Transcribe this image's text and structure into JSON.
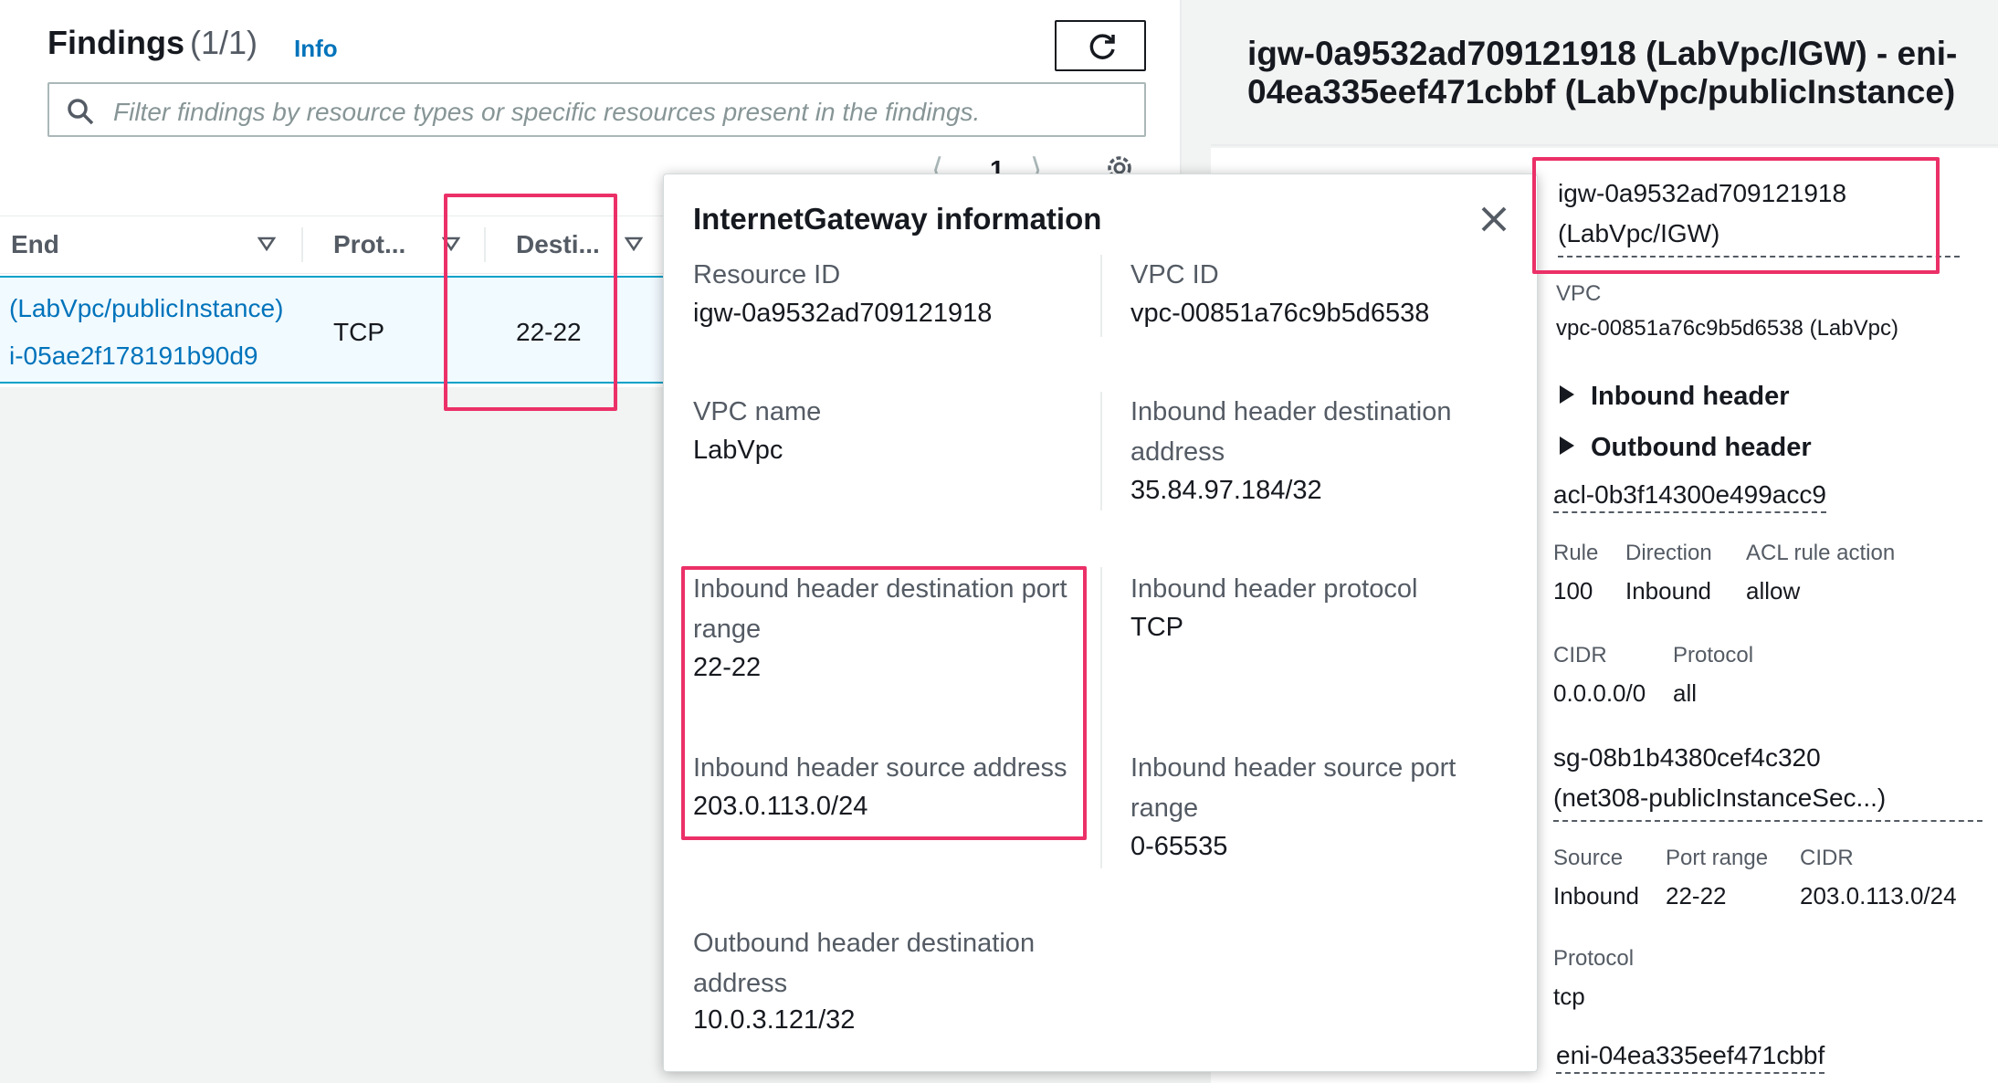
{
  "findings": {
    "title": "Findings",
    "count": "(1/1)",
    "info": "Info",
    "filter_placeholder": "Filter findings by resource types or specific resources present in the findings.",
    "page": "1"
  },
  "table": {
    "columns": [
      "End",
      "Prot...",
      "Desti..."
    ],
    "row": {
      "end_line1": "(LabVpc/publicInstance)",
      "end_line2": "i-05ae2f178191b90d9",
      "protocol": "TCP",
      "destination": "22-22"
    }
  },
  "detail": {
    "title": "igw-0a9532ad709121918 (LabVpc/IGW) - eni-04ea335eef471cbbf (LabVpc/publicInstance)",
    "igw_line1": "igw-0a9532ad709121918",
    "igw_line2": "(LabVpc/IGW)",
    "vpc_label": "VPC",
    "vpc_value": "vpc-00851a76c9b5d6538 (LabVpc)",
    "inbound_header": "Inbound header",
    "outbound_header": "Outbound header",
    "acl_id": "acl-0b3f14300e499acc9",
    "acl_headers": [
      "Rule",
      "Direction",
      "ACL rule action"
    ],
    "acl_values": [
      "100",
      "Inbound",
      "allow"
    ],
    "acl_headers2": [
      "CIDR",
      "Protocol"
    ],
    "acl_values2": [
      "0.0.0.0/0",
      "all"
    ],
    "sg_line1": "sg-08b1b4380cef4c320",
    "sg_line2": "(net308-publicInstanceSec...)",
    "sg_headers": [
      "Source",
      "Port range",
      "CIDR"
    ],
    "sg_values": [
      "Inbound",
      "22-22",
      "203.0.113.0/24"
    ],
    "sg_protocol_label": "Protocol",
    "sg_protocol_value": "tcp",
    "eni": "eni-04ea335eef471cbbf"
  },
  "popover": {
    "title": "InternetGateway information",
    "resource_id_label": "Resource ID",
    "resource_id_value": "igw-0a9532ad709121918",
    "vpc_id_label": "VPC ID",
    "vpc_id_value": "vpc-00851a76c9b5d6538",
    "vpc_name_label": "VPC name",
    "vpc_name_value": "LabVpc",
    "ih_dest_addr_label_1": "Inbound header destination",
    "ih_dest_addr_label_2": "address",
    "ih_dest_addr_value": "35.84.97.184/32",
    "ih_dest_port_label_1": "Inbound header destination port",
    "ih_dest_port_label_2": "range",
    "ih_dest_port_value": "22-22",
    "ih_protocol_label": "Inbound header protocol",
    "ih_protocol_value": "TCP",
    "ih_src_addr_label": "Inbound header source address",
    "ih_src_addr_value": "203.0.113.0/24",
    "ih_src_port_label_1": "Inbound header source port",
    "ih_src_port_label_2": "range",
    "ih_src_port_value": "0-65535",
    "oh_dest_addr_label_1": "Outbound header destination",
    "oh_dest_addr_label_2": "address",
    "oh_dest_addr_value": "10.0.3.121/32"
  },
  "colors": {
    "highlight": "#eb3068",
    "link": "#0073bb",
    "selected_row": "#f1faff"
  }
}
